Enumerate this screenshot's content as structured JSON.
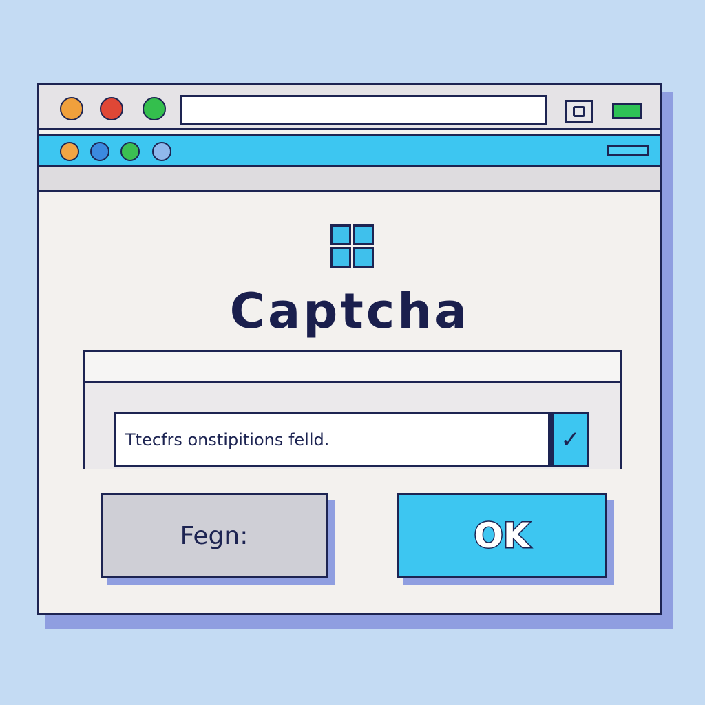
{
  "window": {
    "title_dots": [
      {
        "name": "window-dot-orange",
        "color": "#f0a03c"
      },
      {
        "name": "window-dot-red",
        "color": "#df4736"
      },
      {
        "name": "window-dot-green",
        "color": "#34bf4d"
      }
    ],
    "tab_dots": [
      {
        "name": "tab-dot-orange",
        "color": "#f1a544"
      },
      {
        "name": "tab-dot-blue",
        "color": "#3b8ae0"
      },
      {
        "name": "tab-dot-green",
        "color": "#3bbf52"
      },
      {
        "name": "tab-dot-lightblue",
        "color": "#8fb8ec"
      }
    ],
    "address_value": "",
    "accent_color": "#3dc6f1",
    "dark_color": "#1d2452"
  },
  "dialog": {
    "logo_icon": "windows-logo-icon",
    "title": "Captcha",
    "input_value": "Ttecfrs onstipitions felld.",
    "check_symbol": "✓",
    "cancel_label": "Fegn:",
    "ok_label": "OK"
  }
}
